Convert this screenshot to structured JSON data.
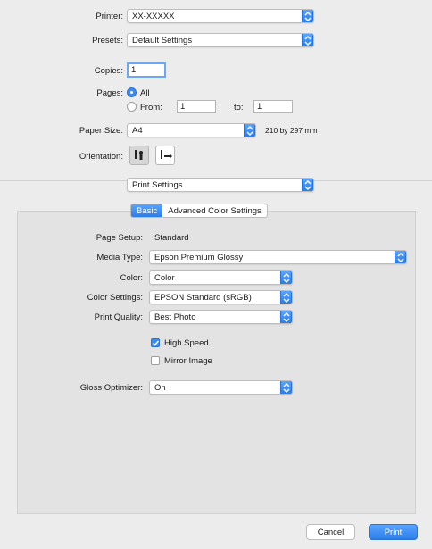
{
  "printer": {
    "label": "Printer:",
    "value": "XX-XXXXX"
  },
  "presets": {
    "label": "Presets:",
    "value": "Default Settings"
  },
  "copies": {
    "label": "Copies:",
    "value": "1"
  },
  "pages": {
    "label": "Pages:",
    "all_label": "All",
    "from_label": "From:",
    "from_value": "1",
    "to_label": "to:",
    "to_value": "1",
    "selected": "All"
  },
  "paper_size": {
    "label": "Paper Size:",
    "value": "A4",
    "dimensions": "210 by 297 mm"
  },
  "orientation": {
    "label": "Orientation:",
    "selected": "portrait"
  },
  "section_popup": {
    "value": "Print Settings"
  },
  "tabs": [
    {
      "label": "Basic",
      "active": true
    },
    {
      "label": "Advanced Color Settings",
      "active": false
    }
  ],
  "basic": {
    "page_setup": {
      "label": "Page Setup:",
      "value": "Standard"
    },
    "media_type": {
      "label": "Media Type:",
      "value": "Epson Premium Glossy"
    },
    "color": {
      "label": "Color:",
      "value": "Color"
    },
    "color_settings": {
      "label": "Color Settings:",
      "value": "EPSON Standard (sRGB)"
    },
    "print_quality": {
      "label": "Print Quality:",
      "value": "Best Photo"
    },
    "high_speed": {
      "label": "High Speed",
      "checked": true
    },
    "mirror_image": {
      "label": "Mirror Image",
      "checked": false
    },
    "gloss_optimizer": {
      "label": "Gloss Optimizer:",
      "value": "On"
    }
  },
  "buttons": {
    "cancel": "Cancel",
    "print": "Print"
  },
  "colors": {
    "accent": "#3b8bf5",
    "background": "#ececec",
    "panel": "#e3e3e3"
  },
  "icons": {
    "popup_stepper": "chevron-updown-icon",
    "checkmark": "checkmark-icon"
  }
}
